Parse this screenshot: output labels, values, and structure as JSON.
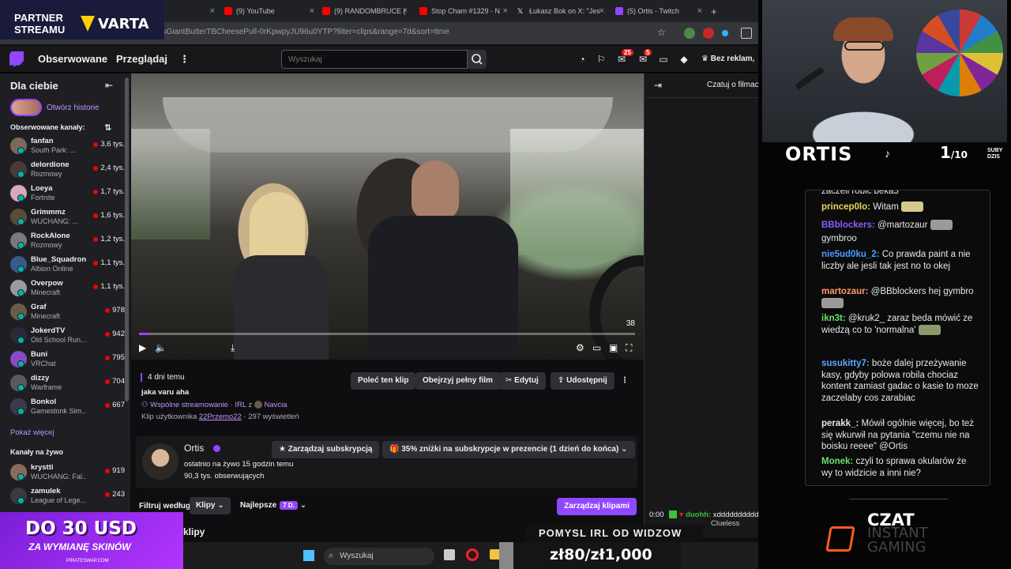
{
  "browser": {
    "tabs": [
      {
        "label": "(9) YouTube",
        "color": "#ff0000"
      },
      {
        "label": "(9) RANDOMBRUCE (",
        "color": "#ff0000"
      },
      {
        "label": "Stop Cham #1329 - N",
        "color": "#ff0000"
      },
      {
        "label": "Łukasz Bok on X: \"Jes",
        "color": "#ffffff"
      },
      {
        "label": "(5) Ortis - Twitch",
        "color": "#9147ff"
      }
    ],
    "url": "tlessGiantButterTBCheesePull-0rKpwpyJU96u0YTP?filter=clips&range=7d&sort=time"
  },
  "topnav": {
    "following": "Obserwowane",
    "browse": "Przeglądaj",
    "search_placeholder": "Wyszukaj",
    "notif_count_1": "25",
    "notif_count_2": "5",
    "ad_free": "Bez reklam,"
  },
  "sidebar": {
    "title": "Dla ciebie",
    "stories": "Otwórz historie",
    "followed_header": "Obserwowane kanały:",
    "channels": [
      {
        "name": "fanfan",
        "game": "South Park: ...",
        "viewers": "3,6 tys.",
        "color": "#7a6a5a"
      },
      {
        "name": "delordione",
        "game": "Rozmowy",
        "viewers": "2,4 tys.",
        "color": "#4a3a3a"
      },
      {
        "name": "Loeya",
        "game": "Fortnite",
        "viewers": "1,7 tys.",
        "color": "#d8a8b8"
      },
      {
        "name": "Grimmmz",
        "game": "WUCHANG: ...",
        "viewers": "1,6 tys.",
        "color": "#5a4a3a"
      },
      {
        "name": "RockAlone",
        "game": "Rozmowy",
        "viewers": "1,2 tys.",
        "color": "#7a7a7a"
      },
      {
        "name": "Blue_Squadron",
        "game": "Albion Online",
        "viewers": "1,1 tys.",
        "color": "#3a5a8a"
      },
      {
        "name": "Overpow",
        "game": "Minecraft",
        "viewers": "1,1 tys.",
        "color": "#9a9a9a"
      },
      {
        "name": "Graf",
        "game": "Minecraft",
        "viewers": "978",
        "color": "#6a5a4a"
      },
      {
        "name": "JokerdTV",
        "game": "Old School Run...",
        "viewers": "942",
        "color": "#2a2a3a"
      },
      {
        "name": "Buni",
        "game": "VRChat",
        "viewers": "795",
        "color": "#8a4ac8"
      },
      {
        "name": "dizzy",
        "game": "Warframe",
        "viewers": "704",
        "color": "#5a5a5a"
      },
      {
        "name": "Bonkol",
        "game": "Gamestonk Sim...",
        "viewers": "667",
        "color": "#3a3a4a"
      }
    ],
    "show_more": "Pokaż więcej",
    "live_header": "Kanały na żywo",
    "live_channels": [
      {
        "name": "krystti",
        "game": "WUCHANG: Fal...",
        "viewers": "919",
        "color": "#8a6a5a"
      },
      {
        "name": "zamulek",
        "game": "League of Lege...",
        "viewers": "243",
        "color": "#3a3a3a"
      }
    ]
  },
  "video": {
    "timestamp": "38",
    "progress": 0.02
  },
  "clip": {
    "ago": "4 dni temu",
    "title": "jaka varu aha",
    "shared": "Wspólne streamowanie",
    "category": "IRL",
    "with": "z",
    "partner": "Navcia",
    "clipped_by": "Klip użytkownika",
    "clipper": "22Przemo22",
    "views": "· 297 wyświetleń",
    "buttons": {
      "recommend": "Poleć ten klip",
      "full": "Obejrzyj pełny film",
      "edit": "Edytuj",
      "share": "Udostępnij"
    }
  },
  "channel": {
    "name": "Ortis",
    "manage_sub": "Zarządzaj subskrypcją",
    "discount": "35% zniżki na subskrypcje w prezencie (1 dzień do końca)",
    "last_live": "ostatnio na żywo 15 godzin temu",
    "followers": "90,3 tys. obserwujących"
  },
  "filters": {
    "filter_by": "Filtruj według",
    "type": "Klipy",
    "sort": "Najlepsze",
    "range": "7 D.",
    "manage": "Zarządzaj klipami",
    "section": "klipy"
  },
  "chatpanel": {
    "header": "Czatuj o filmac",
    "bottom_time": "0:00",
    "bottom_user": "duohh:",
    "bottom_msg": "xddddddddddddddd",
    "bottom_msg2": "Clueless"
  },
  "overlay": {
    "streamer": "ORTIS",
    "sub_count": "1",
    "sub_goal": "/10",
    "sub_label_1": "SUBY",
    "sub_label_2": "DZIS",
    "chat": [
      {
        "user": "",
        "text": "zaczeli robic beka3",
        "color": "#e8e8e8"
      },
      {
        "user": "princep0lo:",
        "text": "Witam",
        "color": "#e6d85a"
      },
      {
        "user": "BBblockers:",
        "text": "@martozaur",
        "color": "#8a5cff"
      },
      {
        "user": "",
        "text": "gymbroo",
        "color": "#e8e8e8"
      },
      {
        "user": "nie5ud0ku_2:",
        "text": "Co prawda paint a nie liczby ale jesli tak jest no to okej",
        "color": "#4f9dff"
      },
      {
        "user": "martozaur:",
        "text": "@BBblockers hej gymbro",
        "color": "#ff9a6a"
      },
      {
        "user": "ikn3t:",
        "text": "@kruk2_ zaraz beda mówić ze wiedzą co to 'normalna'",
        "color": "#6adf6a"
      },
      {
        "user": "susukitty7:",
        "text": "boże dalej przeżywanie kasy, gdyby polowa robila chociaz kontent zamiast gadac o kasie to moze zaczelaby cos zarabiac",
        "color": "#5aa8ff"
      },
      {
        "user": "perakk_:",
        "text": "Mówił ogólnie więcej, bo też się wkurwił na pytania \"czemu nie na boisku reeee\" @Ortis",
        "color": "#e8e8e8"
      },
      {
        "user": "Monek:",
        "text": "czyli to sprawa okularów że wy to widzicie a inni nie?",
        "color": "#6adf6a"
      }
    ],
    "czat": "CZAT",
    "instant": "INSTANT",
    "gaming": "GAMING"
  },
  "stream_overlays": {
    "partner_1": "PARTNER",
    "partner_2": "STREAMU",
    "varta": "VARTA",
    "promo_big": "DO 30 USD",
    "promo_sub": "ZA WYMIANĘ SKINÓW",
    "promo_site": "PIRATESWAP.COM",
    "ticker": "POMYSL IRL OD WIDZOW",
    "goal": "zł80/zł1,000",
    "goal_progress": 0.08,
    "taskbar_search": "Wyszukaj"
  }
}
